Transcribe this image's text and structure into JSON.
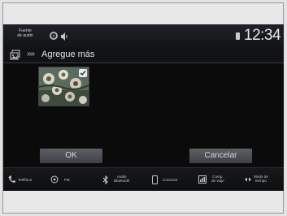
{
  "status_bar": {
    "source_line1": "Fuente",
    "source_line2": "de audio",
    "time": "12:34"
  },
  "title_bar": {
    "breadcrumb": "»»",
    "title": "Agregue más"
  },
  "photo": {
    "selected": true
  },
  "buttons": {
    "ok": "OK",
    "cancel": "Cancelar"
  },
  "nav": {
    "phone": "Teléfono",
    "fm": "FM",
    "bt_line1": "Audio",
    "bt_line2": "Bluetooth",
    "connect": "Conectar",
    "info_line1": "Comp.",
    "info_line2": "de viaje",
    "mode_line1": "Modo de",
    "mode_line2": "tiempo"
  },
  "colors": {
    "screen_bg": "#0b0b0b",
    "button_bg": "#4e5156",
    "text": "#e2e4e8"
  }
}
